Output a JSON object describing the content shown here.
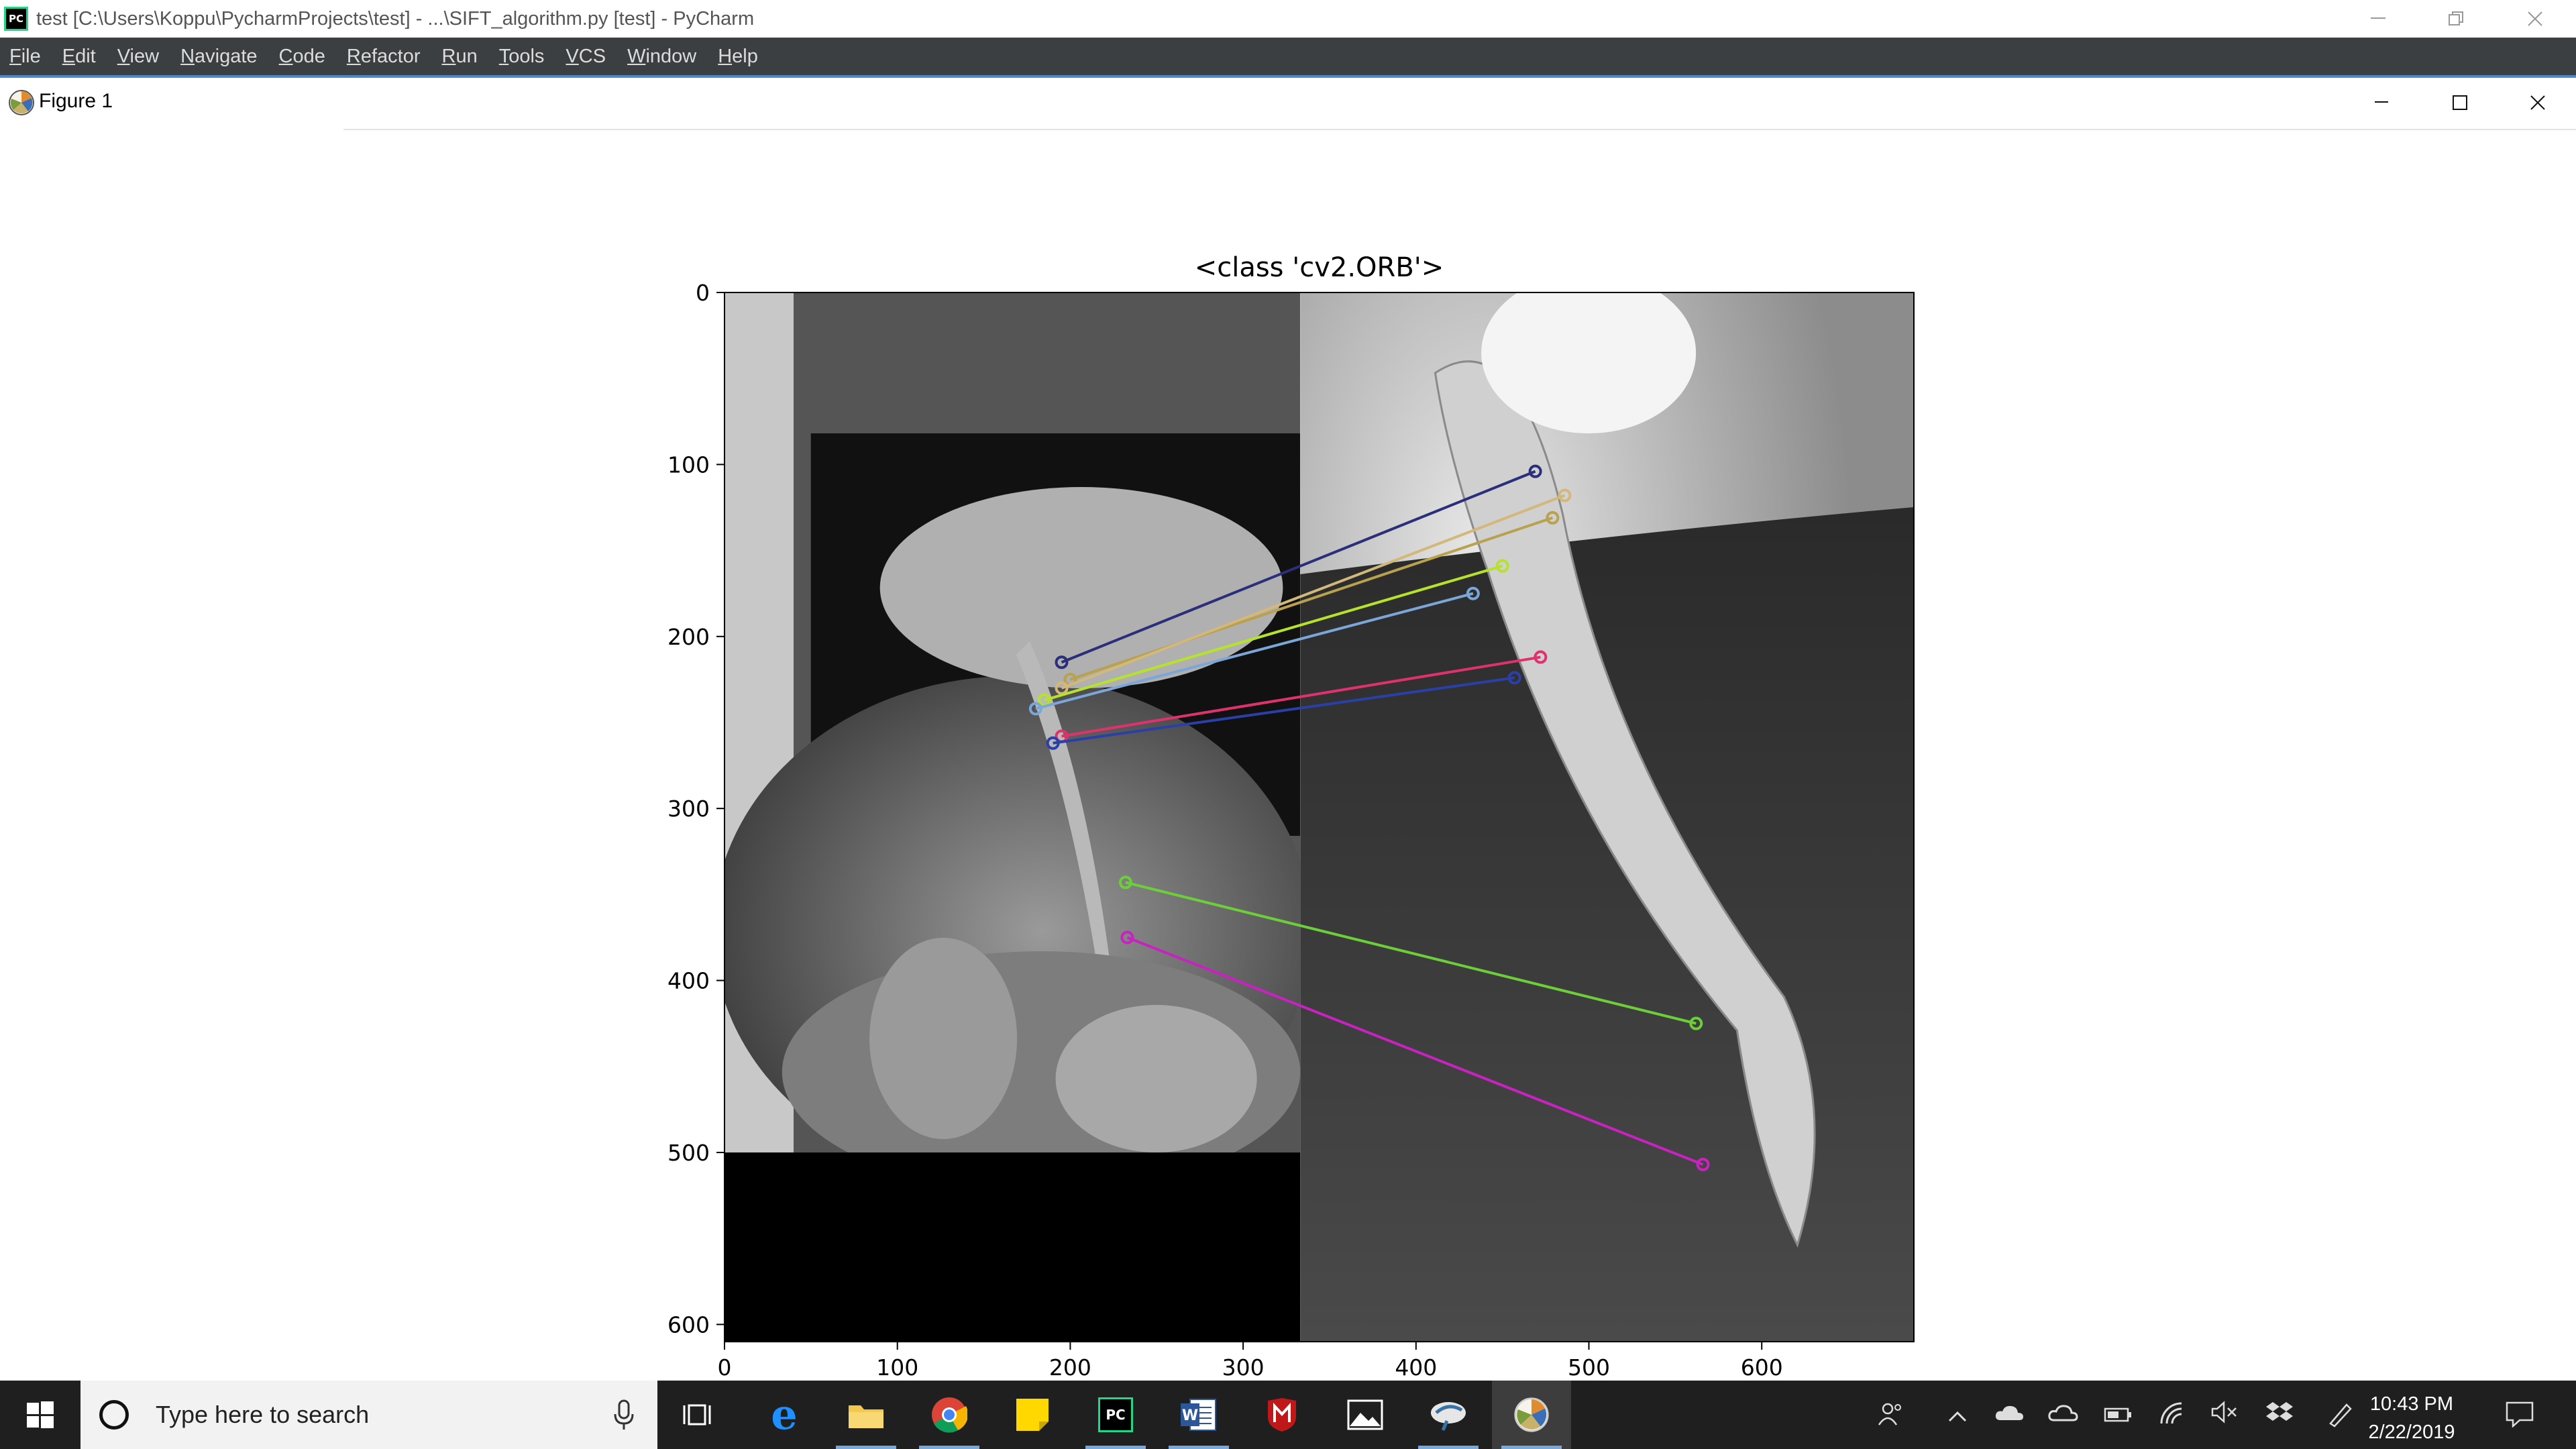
{
  "window": {
    "title": "test [C:\\Users\\Koppu\\PycharmProjects\\test] - ...\\SIFT_algorithm.py [test] - PyCharm",
    "logo_text": "PC"
  },
  "menu": [
    "File",
    "Edit",
    "View",
    "Navigate",
    "Code",
    "Refactor",
    "Run",
    "Tools",
    "VCS",
    "Window",
    "Help"
  ],
  "figure": {
    "title": "Figure 1"
  },
  "chart_data": {
    "type": "image",
    "title": "<class 'cv2.ORB'>",
    "xlim": [
      0,
      688
    ],
    "ylim": [
      610,
      0
    ],
    "xticks": [
      0,
      100,
      200,
      300,
      400,
      500,
      600
    ],
    "yticks": [
      0,
      100,
      200,
      300,
      400,
      500,
      600
    ],
    "xticklabels": [
      "0",
      "100",
      "200",
      "300",
      "400",
      "500",
      "600"
    ],
    "yticklabels": [
      "0",
      "100",
      "200",
      "300",
      "400",
      "500",
      "600"
    ],
    "image_divider_x": 333,
    "left_image_height": 500,
    "matches": [
      {
        "x1": 195,
        "y1": 215,
        "x2": 469,
        "y2": 104,
        "color": "#2b2f7a"
      },
      {
        "x1": 200,
        "y1": 225,
        "x2": 479,
        "y2": 131,
        "color": "#b8a14f"
      },
      {
        "x1": 195,
        "y1": 230,
        "x2": 486,
        "y2": 118,
        "color": "#d2b87a"
      },
      {
        "x1": 185,
        "y1": 237,
        "x2": 450,
        "y2": 159,
        "color": "#b7e22b"
      },
      {
        "x1": 180,
        "y1": 242,
        "x2": 433,
        "y2": 175,
        "color": "#7aa6d8"
      },
      {
        "x1": 195,
        "y1": 258,
        "x2": 472,
        "y2": 212,
        "color": "#e0316f"
      },
      {
        "x1": 190,
        "y1": 262,
        "x2": 457,
        "y2": 224,
        "color": "#2b3fa8"
      },
      {
        "x1": 232,
        "y1": 343,
        "x2": 562,
        "y2": 425,
        "color": "#6ccf3a"
      },
      {
        "x1": 233,
        "y1": 375,
        "x2": 566,
        "y2": 507,
        "color": "#c822c0"
      }
    ]
  },
  "taskbar": {
    "search_placeholder": "Type here to search",
    "clock_time": "10:43 PM",
    "clock_date": "2/22/2019"
  },
  "colors": {
    "titlebar_bg": "#ffffff",
    "menubar_bg": "#3c3f41",
    "taskbar_bg": "#1f1f1f",
    "accent": "#4a88c7"
  },
  "icons": {
    "app": "pycharm-icon",
    "figure": "matplotlib-icon",
    "start": "windows-start-icon"
  }
}
